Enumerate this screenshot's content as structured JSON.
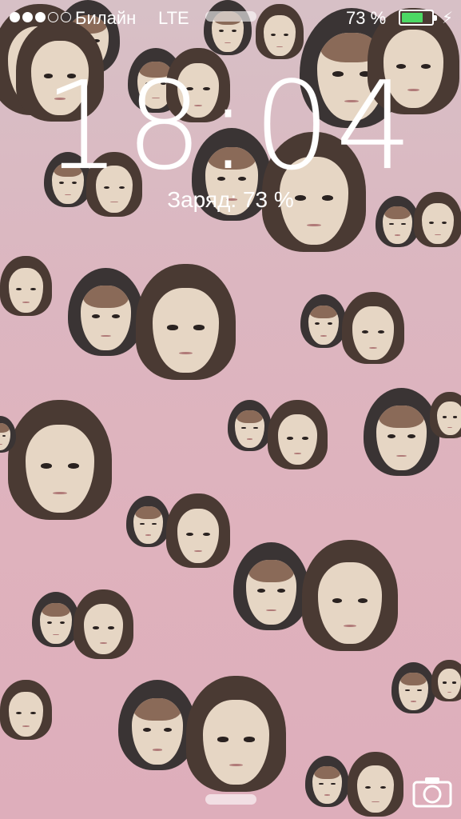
{
  "status_bar": {
    "signal_bars_filled": 3,
    "signal_bars_total": 5,
    "carrier": "Билайн",
    "network": "LTE",
    "battery_percent_text": "73 %",
    "battery_level": 0.73,
    "charging_icon": "bolt-icon",
    "battery_color": "#4cd964"
  },
  "lock_screen": {
    "time": "18:04",
    "charge_status": "Заряд: 73 %",
    "camera_icon": "camera-icon"
  },
  "wallpaper": {
    "description_colors": [
      "#d7c0c6",
      "#deaebb"
    ]
  }
}
